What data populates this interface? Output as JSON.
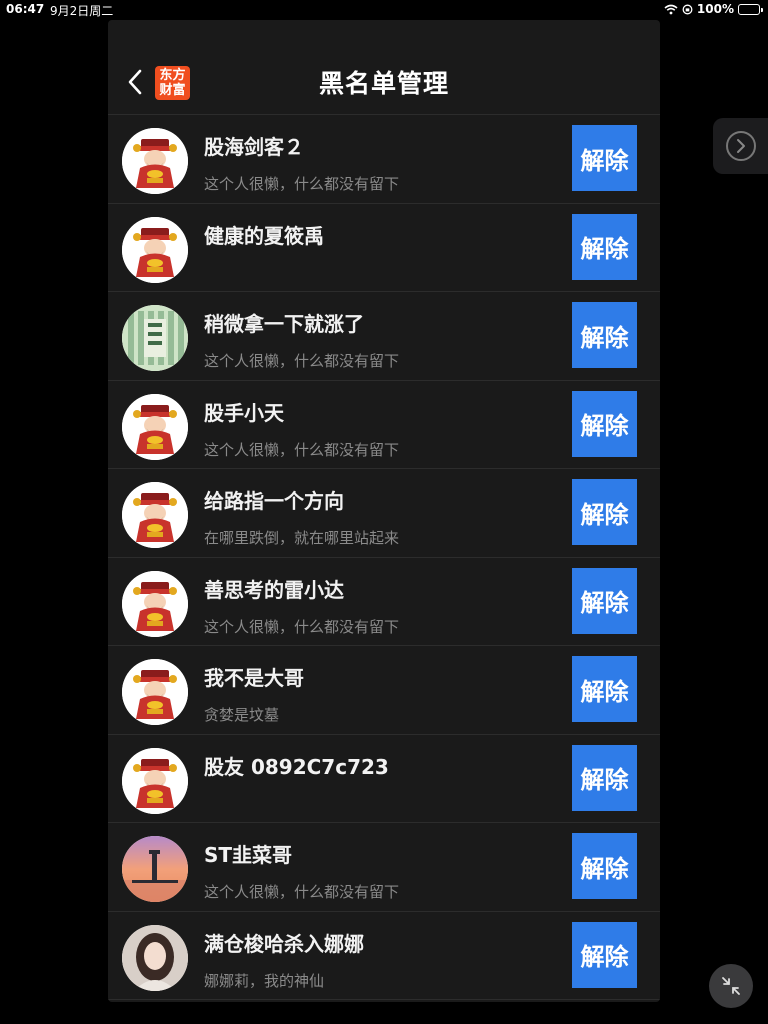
{
  "status_bar": {
    "time": "06:47",
    "date": "9月2日周二",
    "battery": "100%",
    "battery_color": "#3cd25a"
  },
  "header": {
    "logo_line1": "东方",
    "logo_line2": "财富",
    "title": "黑名单管理",
    "logo_color": "#f04e1f"
  },
  "colors": {
    "button": "#2f7ce8",
    "background": "#1a1a1a"
  },
  "users": [
    {
      "name": "股海剑客２",
      "signature": "这个人很懒，什么都没有留下",
      "avatar": "caishen-avatar",
      "button": "解除"
    },
    {
      "name": "健康的夏筱禹",
      "signature": "",
      "avatar": "caishen-avatar",
      "button": "解除"
    },
    {
      "name": "稍微拿一下就涨了",
      "signature": "这个人很懒，什么都没有留下",
      "avatar": "calligraphy-avatar",
      "button": "解除"
    },
    {
      "name": "股手小天",
      "signature": "这个人很懒，什么都没有留下",
      "avatar": "caishen-avatar",
      "button": "解除"
    },
    {
      "name": "给路指一个方向",
      "signature": "在哪里跌倒，就在哪里站起来",
      "avatar": "caishen-avatar",
      "button": "解除"
    },
    {
      "name": "善思考的雷小达",
      "signature": "这个人很懒，什么都没有留下",
      "avatar": "caishen-avatar",
      "button": "解除"
    },
    {
      "name": "我不是大哥",
      "signature": "贪婪是坟墓",
      "avatar": "caishen-avatar",
      "button": "解除"
    },
    {
      "name": "股友 0892C7c723",
      "signature": "",
      "avatar": "caishen-avatar",
      "button": "解除"
    },
    {
      "name": "ST韭菜哥",
      "signature": "这个人很懒，什么都没有留下",
      "avatar": "sunset-avatar",
      "button": "解除"
    },
    {
      "name": "满仓梭哈杀入娜娜",
      "signature": "娜娜莉，我的神仙",
      "avatar": "portrait-avatar",
      "button": "解除"
    }
  ]
}
